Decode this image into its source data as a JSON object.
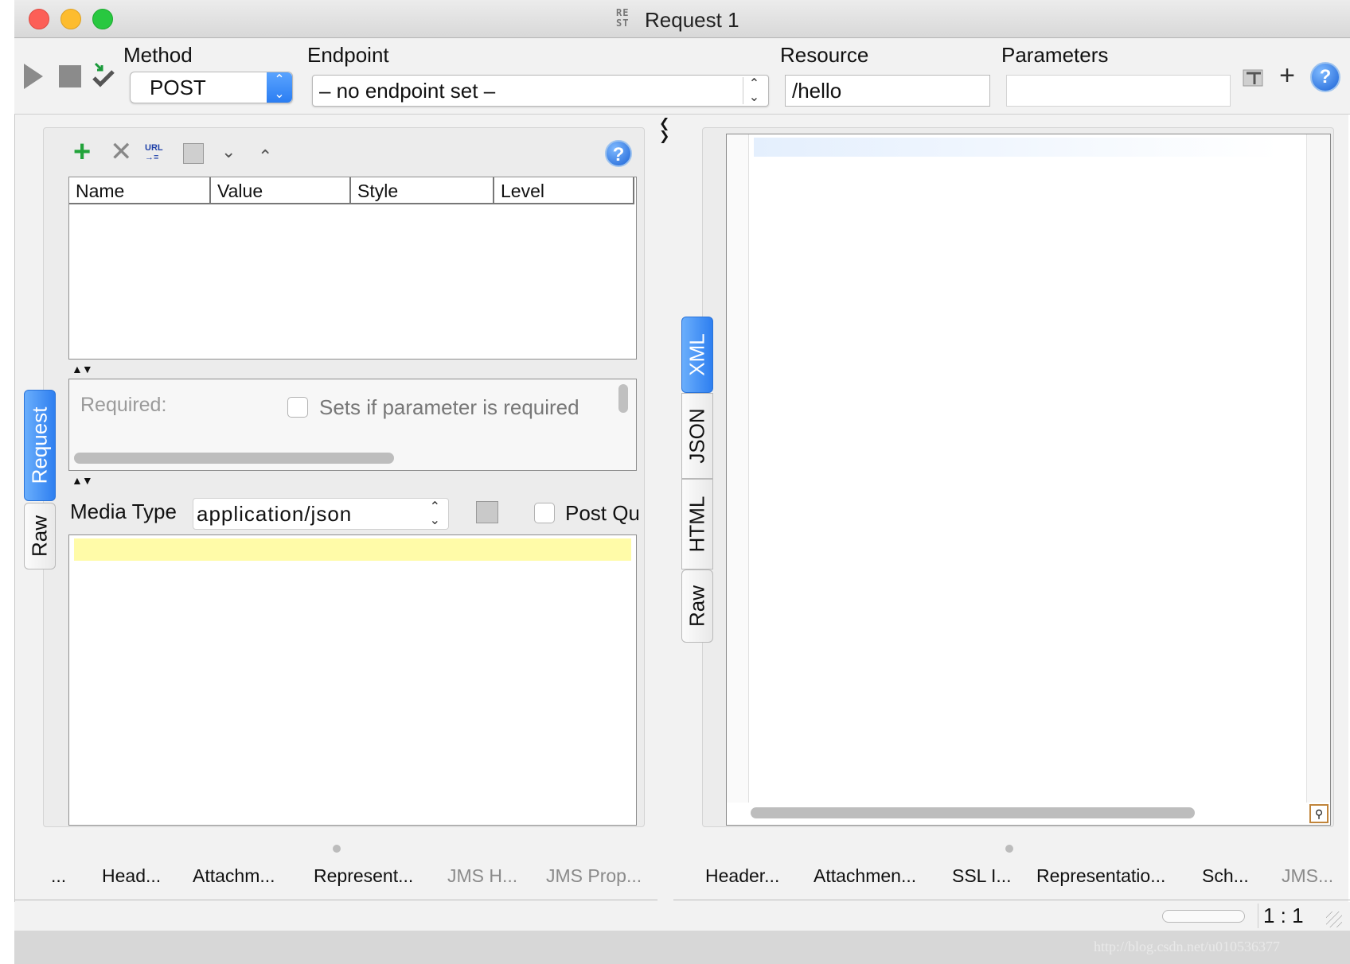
{
  "window": {
    "title": "Request 1",
    "logo_text": "RE ST"
  },
  "toolbar": {
    "method_label": "Method",
    "method_value": "POST",
    "endpoint_label": "Endpoint",
    "endpoint_value": "– no endpoint set –",
    "resource_label": "Resource",
    "resource_value": "/hello",
    "parameters_label": "Parameters",
    "parameters_value": ""
  },
  "params_table": {
    "columns": [
      "Name",
      "Value",
      "Style",
      "Level"
    ]
  },
  "param_detail": {
    "required_label": "Required:",
    "required_hint": "Sets if parameter is required"
  },
  "media": {
    "label": "Media Type",
    "value": "application/json",
    "post_query_label": "Post Qu"
  },
  "left_side_tabs": [
    "Request",
    "Raw"
  ],
  "right_side_tabs": [
    "XML",
    "JSON",
    "HTML",
    "Raw"
  ],
  "left_bottom_tabs": [
    "...",
    "Head...",
    "Attachm...",
    "Represent...",
    "JMS H...",
    "JMS Prop..."
  ],
  "right_bottom_tabs": [
    "Header...",
    "Attachmen...",
    "SSL I...",
    "Representatio...",
    "Sch...",
    "JMS..."
  ],
  "status": {
    "ratio": "1 : 1"
  },
  "watermark": "http://blog.csdn.net/u010536377",
  "colors": {
    "accent": "#2e7ff0",
    "editor_highlight": "#fffba8",
    "close": "#fc5f57",
    "minimize": "#fdbc2e",
    "maximize": "#28c840"
  }
}
